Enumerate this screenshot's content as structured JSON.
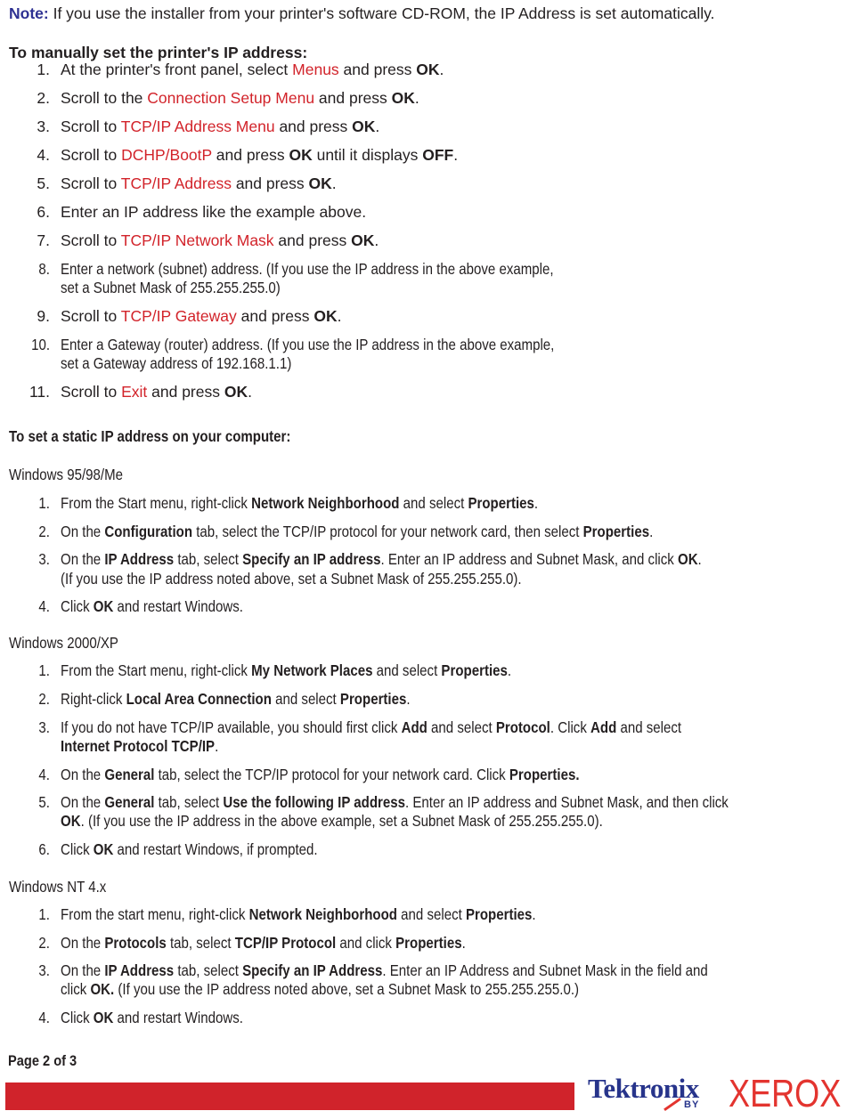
{
  "note": {
    "label": "Note:",
    "text": " If you use the installer from your printer's software CD-ROM, the IP Address is set automatically."
  },
  "manual": {
    "heading": "To manually set the printer's IP address:",
    "steps": [
      {
        "num": "1.",
        "parts": [
          [
            "t",
            "At the printer's front panel, select "
          ],
          [
            "r",
            "Menus"
          ],
          [
            "t",
            " and press "
          ],
          [
            "b",
            "OK"
          ],
          [
            "t",
            "."
          ]
        ]
      },
      {
        "num": "2.",
        "parts": [
          [
            "t",
            "Scroll to the "
          ],
          [
            "r",
            "Connection Setup Menu"
          ],
          [
            "t",
            " and press "
          ],
          [
            "b",
            "OK"
          ],
          [
            "t",
            "."
          ]
        ]
      },
      {
        "num": "3.",
        "parts": [
          [
            "t",
            "Scroll to "
          ],
          [
            "r",
            "TCP/IP Address Menu"
          ],
          [
            "t",
            " and press "
          ],
          [
            "b",
            "OK"
          ],
          [
            "t",
            "."
          ]
        ]
      },
      {
        "num": "4.",
        "parts": [
          [
            "t",
            "Scroll to "
          ],
          [
            "r",
            "DCHP/BootP"
          ],
          [
            "t",
            " and press "
          ],
          [
            "b",
            "OK"
          ],
          [
            "t",
            " until it displays "
          ],
          [
            "b",
            "OFF"
          ],
          [
            "t",
            "."
          ]
        ]
      },
      {
        "num": "5.",
        "parts": [
          [
            "t",
            "Scroll to "
          ],
          [
            "r",
            "TCP/IP Address"
          ],
          [
            "t",
            " and press "
          ],
          [
            "b",
            "OK"
          ],
          [
            "t",
            "."
          ]
        ]
      },
      {
        "num": "6.",
        "parts": [
          [
            "t",
            "Enter an IP address like the example above."
          ]
        ]
      },
      {
        "num": "7.",
        "parts": [
          [
            "t",
            "Scroll to "
          ],
          [
            "r",
            "TCP/IP Network Mask"
          ],
          [
            "t",
            " and press "
          ],
          [
            "b",
            "OK"
          ],
          [
            "t",
            "."
          ]
        ]
      },
      {
        "num": "8.",
        "lines": [
          [
            [
              "t",
              "Enter a network (subnet) address. (If you use the IP address in the above example,"
            ]
          ],
          [
            [
              "t",
              "set a Subnet Mask of 255.255.255.0)"
            ]
          ]
        ]
      },
      {
        "num": "9.",
        "parts": [
          [
            "t",
            "Scroll to "
          ],
          [
            "r",
            "TCP/IP Gateway"
          ],
          [
            "t",
            " and press "
          ],
          [
            "b",
            "OK"
          ],
          [
            "t",
            "."
          ]
        ]
      },
      {
        "num": "10.",
        "lines": [
          [
            [
              "t",
              "Enter a Gateway (router) address. (If you use the IP address in the above example,"
            ]
          ],
          [
            [
              "t",
              "set a Gateway address of 192.168.1.1)"
            ]
          ]
        ]
      },
      {
        "num": "11.",
        "parts": [
          [
            "t",
            "Scroll to "
          ],
          [
            "r",
            "Exit"
          ],
          [
            "t",
            " and press "
          ],
          [
            "b",
            "OK"
          ],
          [
            "t",
            "."
          ]
        ]
      }
    ]
  },
  "static": {
    "heading": "To set a static IP address on your computer:",
    "sections": [
      {
        "title": "Windows 95/98/Me",
        "steps": [
          {
            "num": "1.",
            "lines": [
              [
                [
                  "t",
                  "From the Start menu, right-click "
                ],
                [
                  "b",
                  "Network Neighborhood"
                ],
                [
                  "t",
                  " and select "
                ],
                [
                  "b",
                  "Properties"
                ],
                [
                  "t",
                  "."
                ]
              ]
            ]
          },
          {
            "num": "2.",
            "lines": [
              [
                [
                  "t",
                  "On the "
                ],
                [
                  "b",
                  "Configuration"
                ],
                [
                  "t",
                  " tab, select the TCP/IP protocol for your network card, then select "
                ],
                [
                  "b",
                  "Properties"
                ],
                [
                  "t",
                  "."
                ]
              ]
            ]
          },
          {
            "num": "3.",
            "lines": [
              [
                [
                  "t",
                  "On the "
                ],
                [
                  "b",
                  "IP Address"
                ],
                [
                  "t",
                  " tab, select "
                ],
                [
                  "b",
                  "Specify an IP address"
                ],
                [
                  "t",
                  ". Enter an IP address and Subnet Mask, and click "
                ],
                [
                  "b",
                  "OK"
                ],
                [
                  "t",
                  "."
                ]
              ],
              [
                [
                  "t",
                  "(If you use the IP address noted above, set a Subnet Mask of 255.255.255.0)."
                ]
              ]
            ]
          },
          {
            "num": "4.",
            "lines": [
              [
                [
                  "t",
                  "Click "
                ],
                [
                  "b",
                  "OK"
                ],
                [
                  "t",
                  " and restart Windows."
                ]
              ]
            ]
          }
        ]
      },
      {
        "title": "Windows 2000/XP",
        "steps": [
          {
            "num": "1.",
            "lines": [
              [
                [
                  "t",
                  "From the Start menu, right-click "
                ],
                [
                  "b",
                  "My Network Places"
                ],
                [
                  "t",
                  " and select "
                ],
                [
                  "b",
                  "Properties"
                ],
                [
                  "t",
                  "."
                ]
              ]
            ]
          },
          {
            "num": "2.",
            "lines": [
              [
                [
                  "t",
                  "Right-click "
                ],
                [
                  "b",
                  "Local Area Connection"
                ],
                [
                  "t",
                  " and select "
                ],
                [
                  "b",
                  "Properties"
                ],
                [
                  "t",
                  "."
                ]
              ]
            ]
          },
          {
            "num": "3.",
            "lines": [
              [
                [
                  "t",
                  "If you do not have TCP/IP available, you should first click "
                ],
                [
                  "b",
                  "Add"
                ],
                [
                  "t",
                  " and select "
                ],
                [
                  "b",
                  "Protocol"
                ],
                [
                  "t",
                  ". Click "
                ],
                [
                  "b",
                  "Add"
                ],
                [
                  "t",
                  " and select"
                ]
              ],
              [
                [
                  "b",
                  "Internet Protocol TCP/IP"
                ],
                [
                  "t",
                  "."
                ]
              ]
            ]
          },
          {
            "num": "4.",
            "lines": [
              [
                [
                  "t",
                  "On the "
                ],
                [
                  "b",
                  "General"
                ],
                [
                  "t",
                  " tab, select the TCP/IP protocol for your network card. Click "
                ],
                [
                  "b",
                  "Properties."
                ]
              ]
            ]
          },
          {
            "num": "5.",
            "lines": [
              [
                [
                  "t",
                  "On the "
                ],
                [
                  "b",
                  "General"
                ],
                [
                  "t",
                  " tab, select "
                ],
                [
                  "b",
                  "Use the following IP address"
                ],
                [
                  "t",
                  ". Enter an IP address and Subnet Mask, and then click"
                ]
              ],
              [
                [
                  "b",
                  "OK"
                ],
                [
                  "t",
                  ".  (If you use the IP address in the above example, set a Subnet Mask of 255.255.255.0)."
                ]
              ]
            ]
          },
          {
            "num": "6.",
            "lines": [
              [
                [
                  "t",
                  "Click "
                ],
                [
                  "b",
                  "OK"
                ],
                [
                  "t",
                  " and restart Windows, if prompted."
                ]
              ]
            ]
          }
        ]
      },
      {
        "title": "Windows NT 4.x",
        "steps": [
          {
            "num": "1.",
            "lines": [
              [
                [
                  "t",
                  "From the start menu, right-click "
                ],
                [
                  "b",
                  "Network Neighborhood"
                ],
                [
                  "t",
                  " and select "
                ],
                [
                  "b",
                  "Properties"
                ],
                [
                  "t",
                  "."
                ]
              ]
            ]
          },
          {
            "num": "2.",
            "lines": [
              [
                [
                  "t",
                  "On the "
                ],
                [
                  "b",
                  "Protocols"
                ],
                [
                  "t",
                  " tab, select "
                ],
                [
                  "b",
                  "TCP/IP Protocol"
                ],
                [
                  "t",
                  " and click "
                ],
                [
                  "b",
                  "Properties"
                ],
                [
                  "t",
                  "."
                ]
              ]
            ]
          },
          {
            "num": "3.",
            "lines": [
              [
                [
                  "t",
                  "On the "
                ],
                [
                  "b",
                  "IP Address"
                ],
                [
                  "t",
                  " tab, select "
                ],
                [
                  "b",
                  "Specify an IP Address"
                ],
                [
                  "t",
                  ". Enter an IP Address and Subnet Mask in the field and"
                ]
              ],
              [
                [
                  "t",
                  "click "
                ],
                [
                  "b",
                  "OK."
                ],
                [
                  "t",
                  " (If you use the IP address noted above, set a Subnet Mask to 255.255.255.0.)"
                ]
              ]
            ]
          },
          {
            "num": "4.",
            "lines": [
              [
                [
                  "t",
                  "Click "
                ],
                [
                  "b",
                  "OK"
                ],
                [
                  "t",
                  " and restart Windows."
                ]
              ]
            ]
          }
        ]
      }
    ]
  },
  "footer": {
    "page": "Page 2 of 3",
    "logo_tek": "Tektronix",
    "logo_by": "BY",
    "logo_xerox": "XEROX",
    "colors": {
      "red": "#d0232b",
      "blue": "#27348b",
      "xerox": "#e3342f",
      "note": "#2e3192"
    }
  }
}
